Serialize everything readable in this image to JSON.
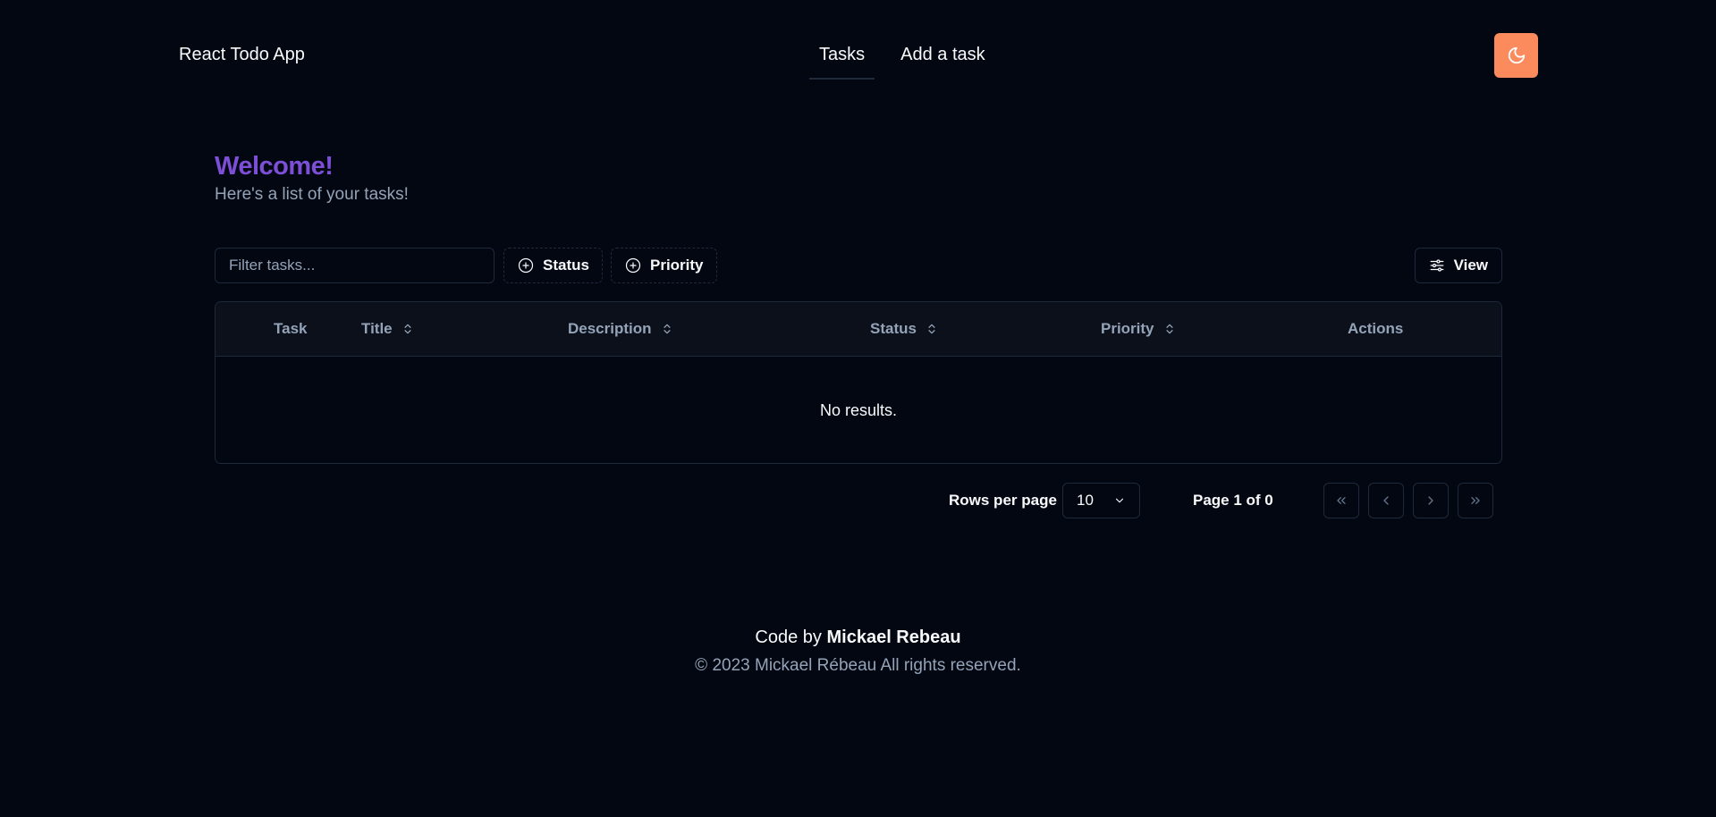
{
  "header": {
    "brand": "React Todo App",
    "nav": [
      {
        "label": "Tasks",
        "active": true
      },
      {
        "label": "Add a task",
        "active": false
      }
    ],
    "theme_toggle": {
      "icon": "moon-icon",
      "color": "#fb8a5c"
    }
  },
  "main": {
    "welcome": "Welcome!",
    "subtitle": "Here's a list of your tasks!",
    "welcome_color": "#7c4fd6"
  },
  "toolbar": {
    "filter_placeholder": "Filter tasks...",
    "status_filter_label": "Status",
    "priority_filter_label": "Priority",
    "view_label": "View"
  },
  "table": {
    "columns": [
      {
        "label": "Task",
        "sortable": false
      },
      {
        "label": "Title",
        "sortable": true
      },
      {
        "label": "Description",
        "sortable": true
      },
      {
        "label": "Status",
        "sortable": true
      },
      {
        "label": "Priority",
        "sortable": true
      },
      {
        "label": "Actions",
        "sortable": false
      }
    ],
    "empty_text": "No results."
  },
  "pagination": {
    "rows_per_page_label": "Rows per page",
    "rows_per_page_value": "10",
    "page_label": "Page 1 of 0"
  },
  "footer": {
    "code_by_prefix": "Code by",
    "author": "Mickael Rebeau",
    "copyright": "© 2023 Mickael Rébeau All rights reserved."
  }
}
